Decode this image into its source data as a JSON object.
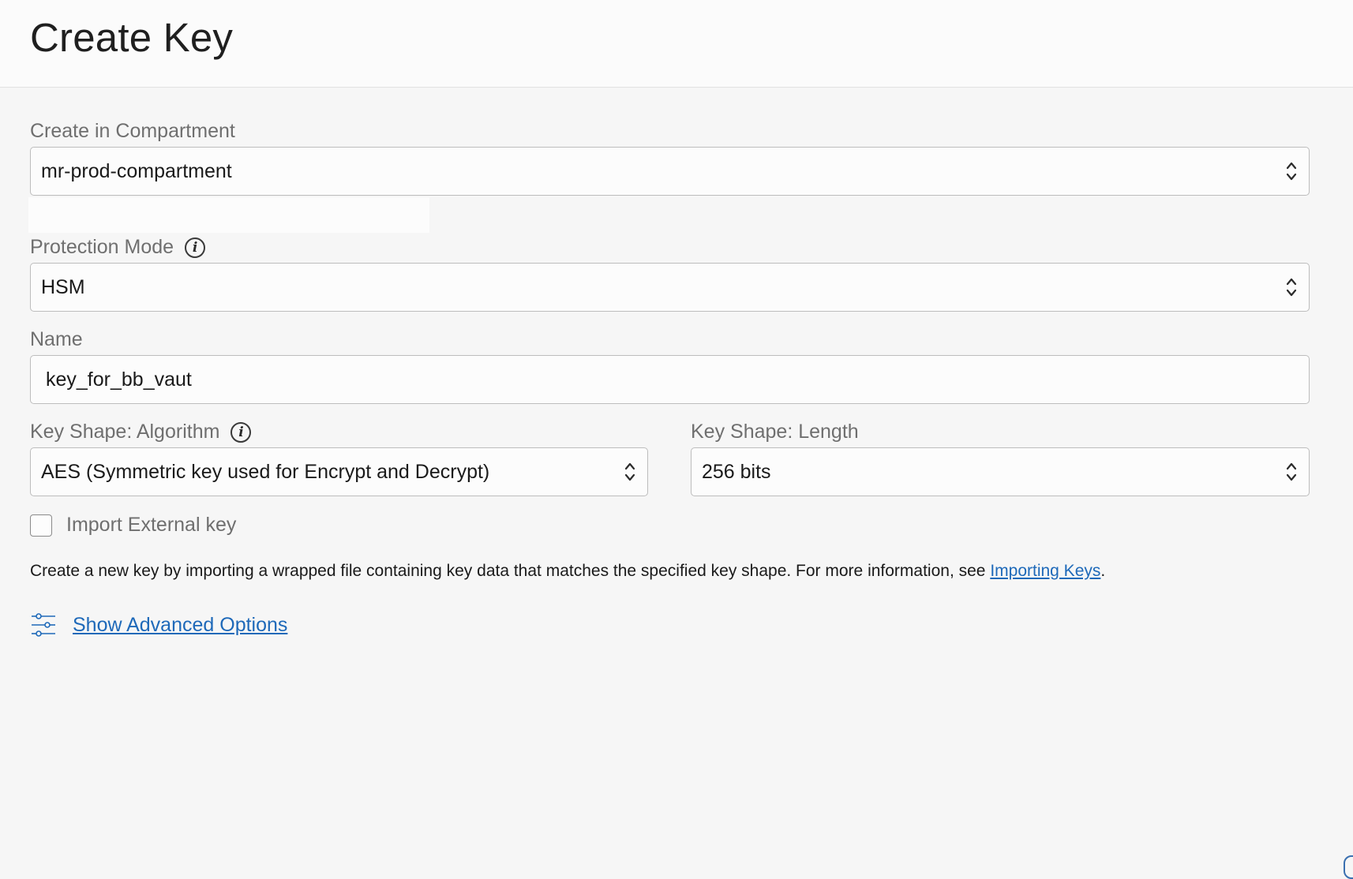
{
  "header": {
    "title": "Create Key"
  },
  "form": {
    "compartment": {
      "label": "Create in Compartment",
      "value": "mr-prod-compartment"
    },
    "protection_mode": {
      "label": "Protection Mode",
      "value": "HSM"
    },
    "name": {
      "label": "Name",
      "value": "key_for_bb_vaut"
    },
    "algorithm": {
      "label": "Key Shape: Algorithm",
      "value": "AES (Symmetric key used for Encrypt and Decrypt)"
    },
    "length": {
      "label": "Key Shape: Length",
      "value": "256 bits"
    },
    "import_external": {
      "label": "Import External key",
      "checked": false
    },
    "help": {
      "text": "Create a new key by importing a wrapped file containing key data that matches the specified key shape. For more information, see ",
      "link_label": "Importing Keys",
      "suffix": "."
    },
    "advanced": {
      "label": "Show Advanced Options",
      "icon": "sliders-icon"
    }
  },
  "colors": {
    "link": "#1e69b9",
    "label": "#6f6f6f",
    "border": "#bdbdbd",
    "background": "#f6f6f6"
  }
}
